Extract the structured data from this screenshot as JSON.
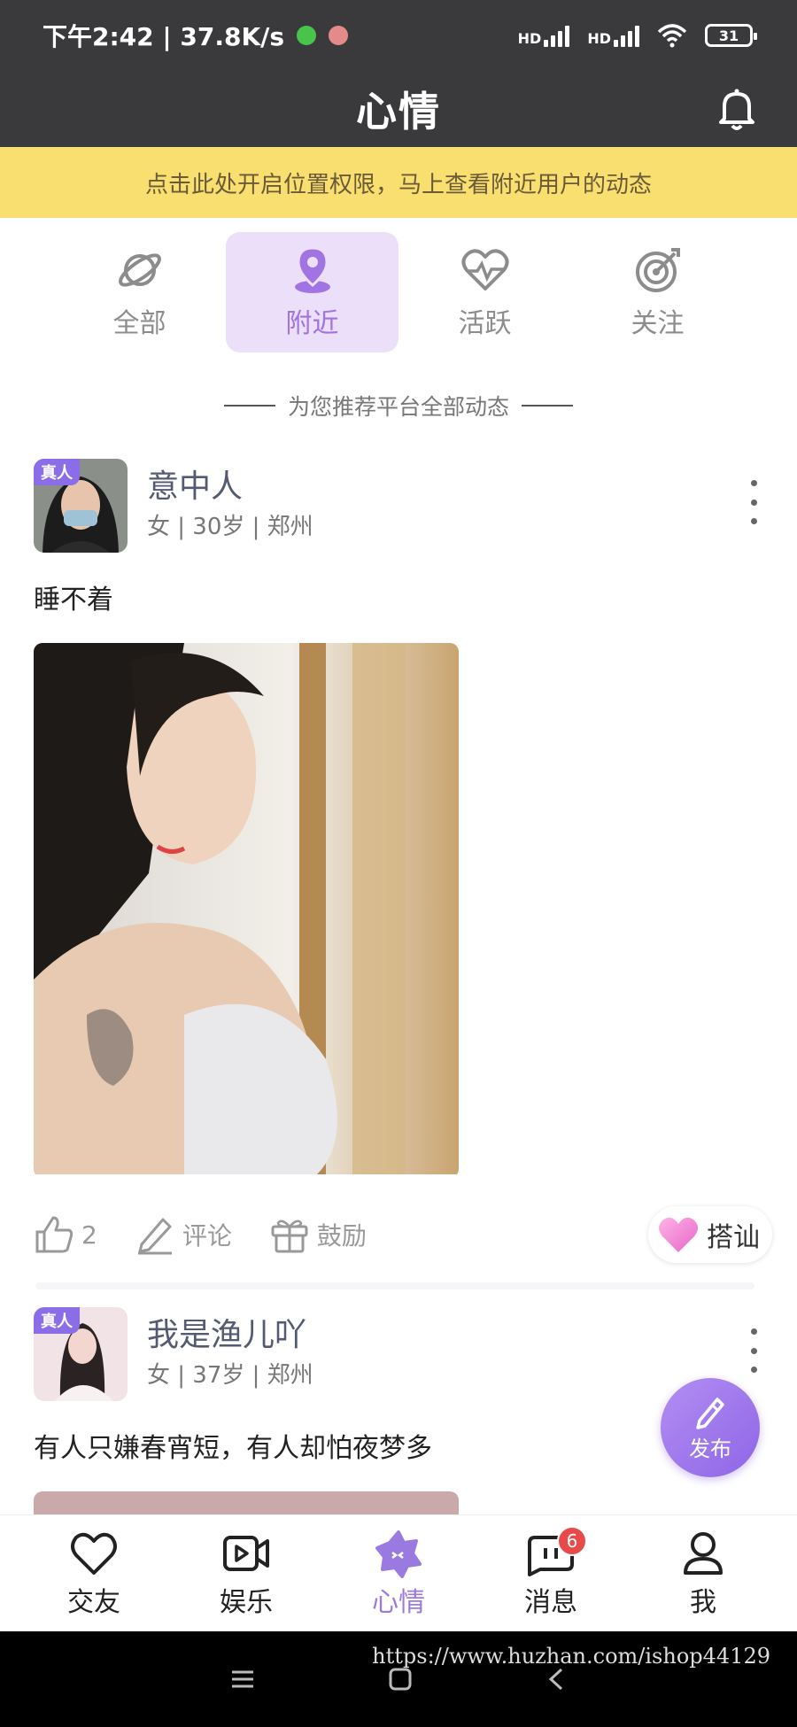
{
  "status_bar": {
    "time_speed": "下午2:42 | 37.8K/s",
    "network_1": "HD",
    "network_2": "HD",
    "battery": "31"
  },
  "header": {
    "title": "心情"
  },
  "location_banner": {
    "text": "点击此处开启位置权限，马上查看附近用户的动态"
  },
  "tabs": [
    {
      "label": "全部",
      "icon": "planet-icon",
      "active": false
    },
    {
      "label": "附近",
      "icon": "location-pin-icon",
      "active": true
    },
    {
      "label": "活跃",
      "icon": "heartbeat-icon",
      "active": false
    },
    {
      "label": "关注",
      "icon": "target-icon",
      "active": false
    }
  ],
  "recommend_text": "为您推荐平台全部动态",
  "posts": [
    {
      "badge": "真人",
      "username": "意中人",
      "meta": "女 | 30岁 | 郑州",
      "text": "睡不着",
      "likes": "2",
      "comment_label": "评论",
      "encourage_label": "鼓励",
      "flirt_label": "搭讪"
    },
    {
      "badge": "真人",
      "username": "我是渔儿吖",
      "meta": "女 | 37岁 | 郑州",
      "text": "有人只嫌春宵短，有人却怕夜梦多"
    }
  ],
  "fab": {
    "label": "发布"
  },
  "bottom_nav": [
    {
      "label": "交友",
      "icon": "heart-outline-icon"
    },
    {
      "label": "娱乐",
      "icon": "video-icon"
    },
    {
      "label": "心情",
      "icon": "mood-star-icon",
      "active": true
    },
    {
      "label": "消息",
      "icon": "message-icon",
      "badge": "6"
    },
    {
      "label": "我",
      "icon": "user-icon"
    }
  ],
  "watermark": "https://www.huzhan.com/ishop44129",
  "colors": {
    "accent": "#a273e3",
    "banner": "#f8df6f",
    "header": "#3a3a3c",
    "badge_red": "#e84a4a"
  }
}
